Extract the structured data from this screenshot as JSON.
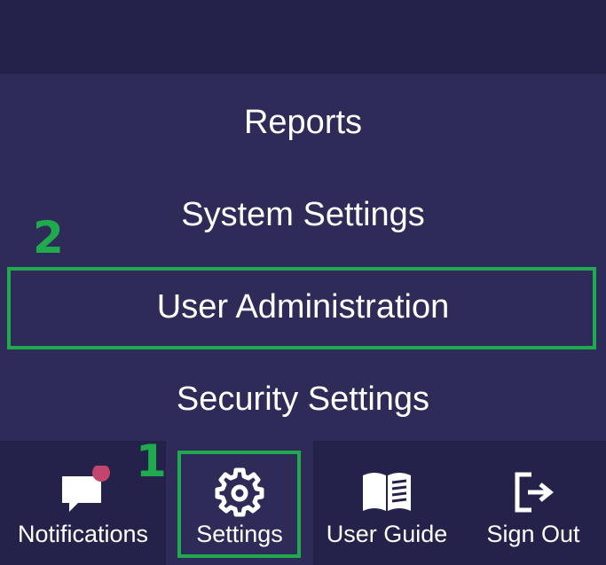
{
  "menu": {
    "items": [
      {
        "label": "Reports"
      },
      {
        "label": "System Settings"
      },
      {
        "label": "User Administration"
      },
      {
        "label": "Security Settings"
      }
    ]
  },
  "annotations": {
    "step_one": "1",
    "step_two": "2",
    "highlight_color": "#1faa4e"
  },
  "nav": {
    "notifications": {
      "label": "Notifications",
      "icon": "chat-bubble-icon",
      "badge_color": "#c2456e"
    },
    "settings": {
      "label": "Settings",
      "icon": "gear-icon"
    },
    "user_guide": {
      "label": "User Guide",
      "icon": "book-icon"
    },
    "sign_out": {
      "label": "Sign Out",
      "icon": "sign-out-icon"
    }
  },
  "colors": {
    "background": "#24224a",
    "panel": "#2e2b59",
    "text": "#ffffff"
  }
}
